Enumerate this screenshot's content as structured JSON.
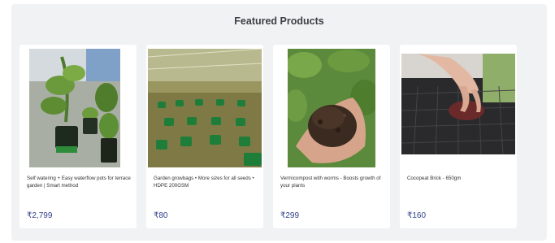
{
  "section": {
    "title": "Featured Products"
  },
  "products": [
    {
      "name": "Self watering + Easy waterflow pots for terrace garden | Smart method",
      "price": "₹2,799",
      "image": "potted-plants-photo"
    },
    {
      "name": "Garden growbags • More sizes for all seeds • HDPE 200GSM",
      "price": "₹80",
      "image": "growbags-greenhouse-photo"
    },
    {
      "name": "Vermicompost with worms - Boosts growth of your plants",
      "price": "₹299",
      "image": "compost-in-hand-photo"
    },
    {
      "name": "Cocopeat Brick - 650gm",
      "price": "₹160",
      "image": "cocopeat-seed-tray-photo"
    }
  ],
  "colors": {
    "price": "#2f3f8a",
    "background": "#f1f2f4"
  }
}
